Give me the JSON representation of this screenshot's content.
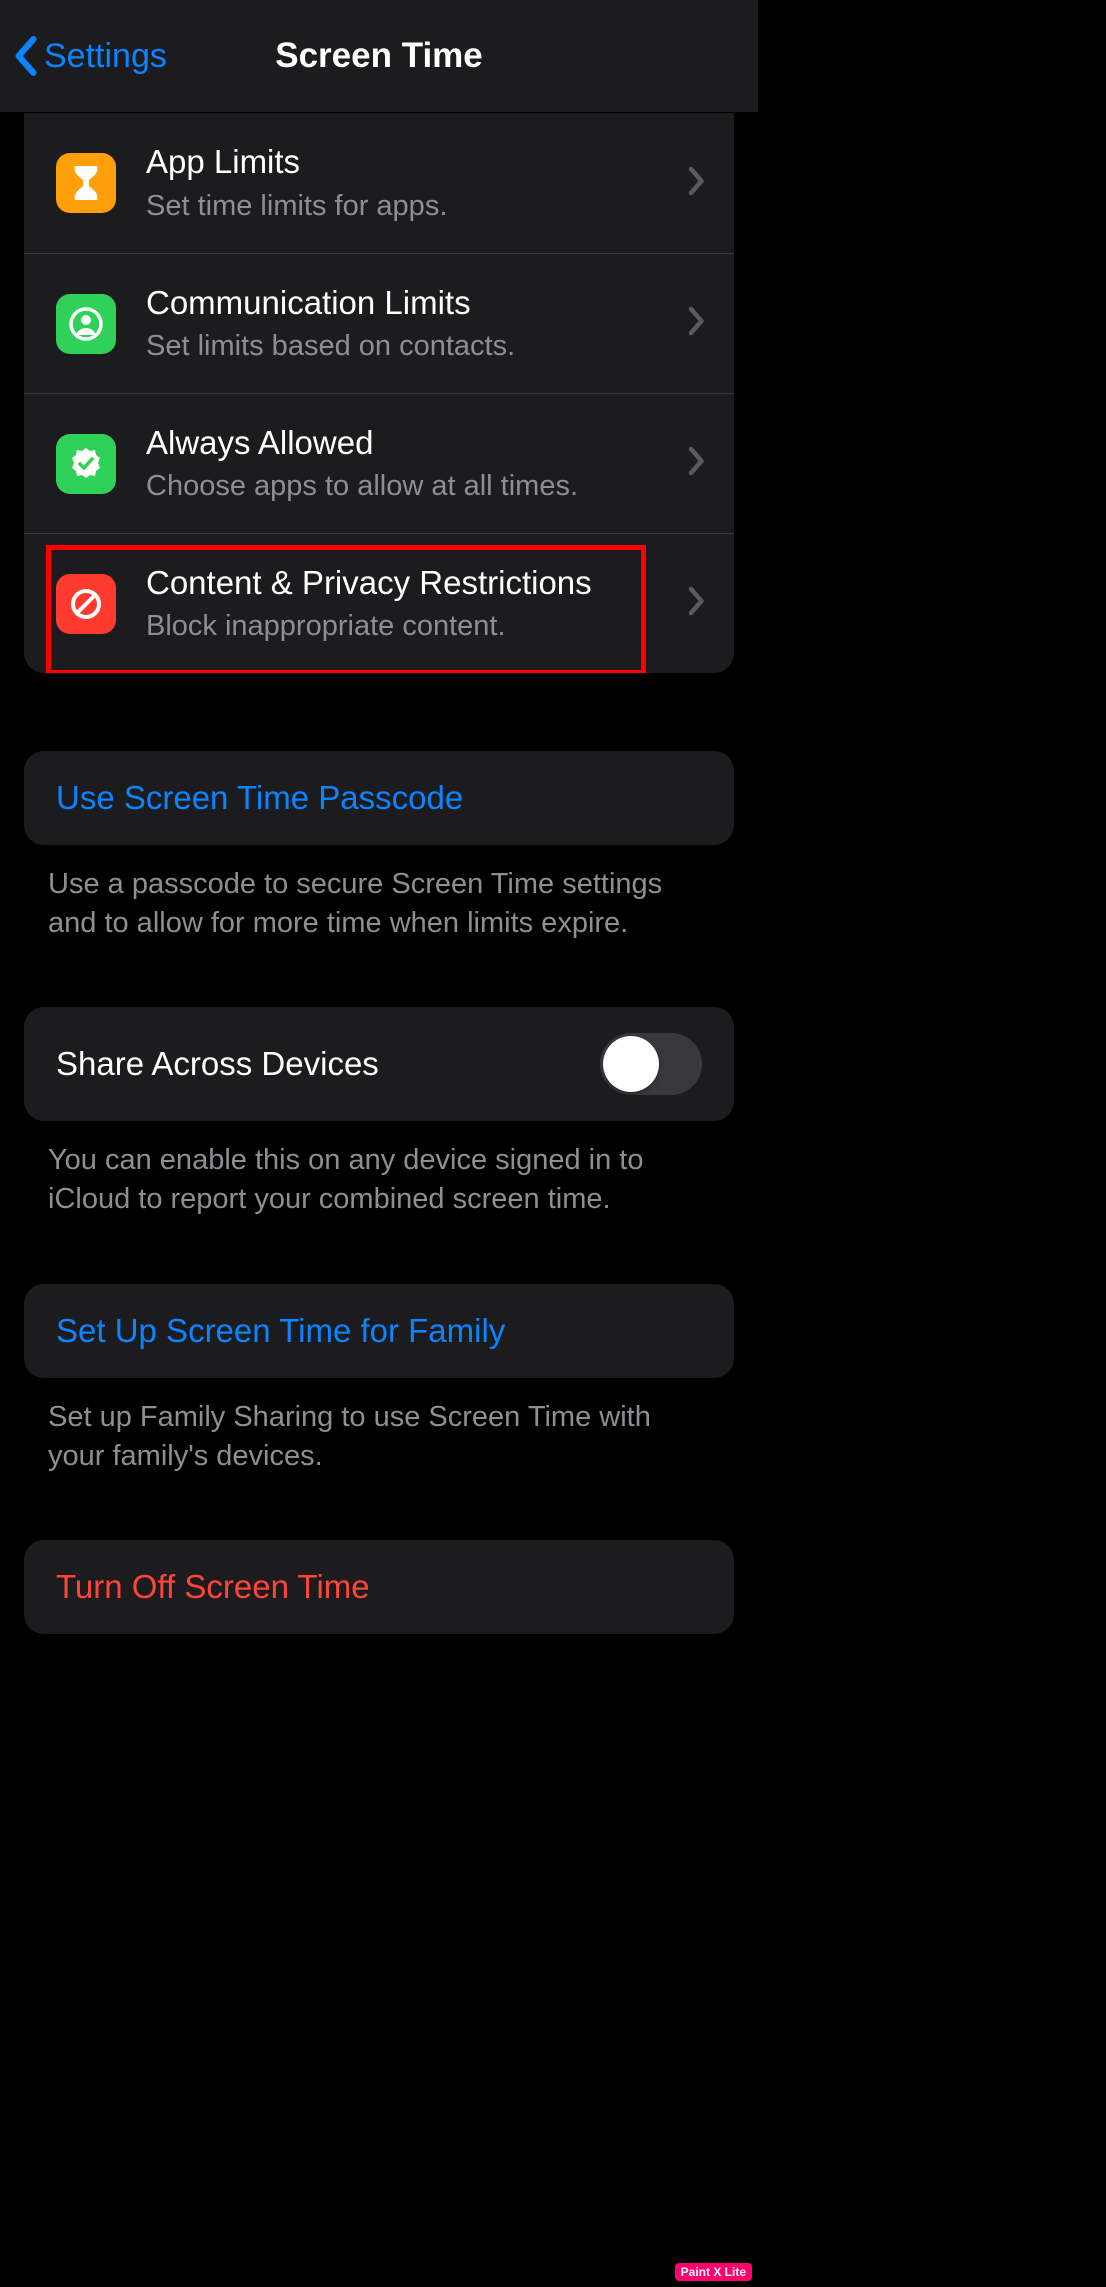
{
  "nav": {
    "back": "Settings",
    "title": "Screen Time"
  },
  "items": [
    {
      "icon": "hourglass",
      "color": "orange",
      "title": "App Limits",
      "sub": "Set time limits for apps."
    },
    {
      "icon": "person",
      "color": "green",
      "title": "Communication Limits",
      "sub": "Set limits based on contacts."
    },
    {
      "icon": "seal",
      "color": "green",
      "title": "Always Allowed",
      "sub": "Choose apps to allow at all times."
    },
    {
      "icon": "nosign",
      "color": "red",
      "title": "Content & Privacy Restrictions",
      "sub": "Block inappropriate content."
    }
  ],
  "passcode": {
    "label": "Use Screen Time Passcode",
    "footer": "Use a passcode to secure Screen Time settings and to allow for more time when limits expire."
  },
  "share": {
    "label": "Share Across Devices",
    "on": false,
    "footer": "You can enable this on any device signed in to iCloud to report your combined screen time."
  },
  "family": {
    "label": "Set Up Screen Time for Family",
    "footer": "Set up Family Sharing to use Screen Time with your family's devices."
  },
  "turnoff": {
    "label": "Turn Off Screen Time"
  },
  "watermark": "Paint X Lite",
  "highlight_row_index": 3
}
